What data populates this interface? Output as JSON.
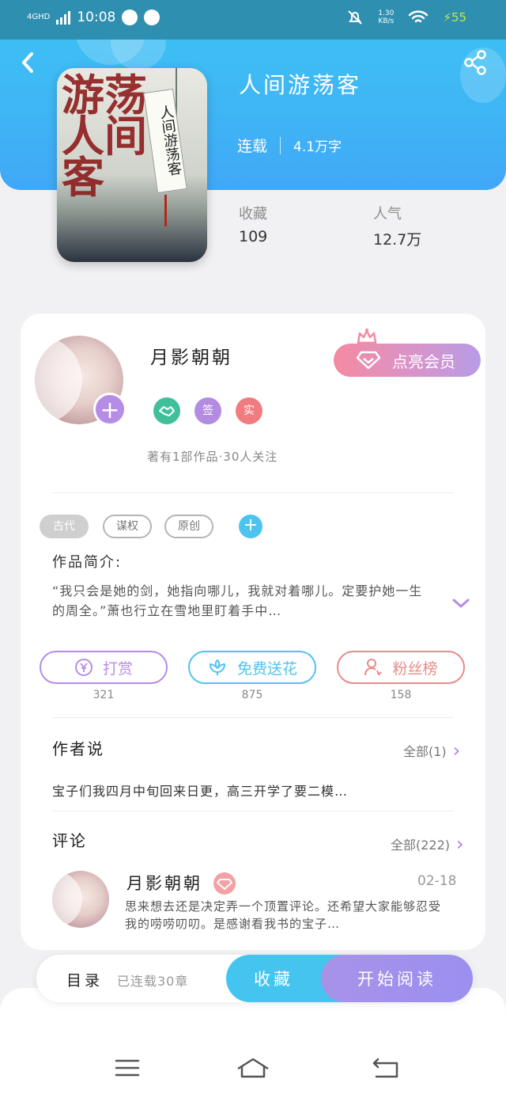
{
  "status_bar": {
    "network": "4GHD",
    "time": "10:08",
    "speed_value": "1.30",
    "speed_unit": "KB/s",
    "battery": "55"
  },
  "book": {
    "title": "人间游荡客",
    "status": "连载",
    "word_count": "4.1万字",
    "cover_title": "人间游荡客",
    "cover_calligraphy": "游荡人间客"
  },
  "stats": {
    "favorites_label": "收藏",
    "favorites_value": "109",
    "popularity_label": "人气",
    "popularity_value": "12.7万"
  },
  "author": {
    "name": "月影朝朝",
    "vip_label": "点亮会员",
    "badges": [
      {
        "text": "",
        "color": "#3fbf9b",
        "icon": "handshake-icon"
      },
      {
        "text": "签",
        "color": "#b38be0"
      },
      {
        "text": "实",
        "color": "#f07c80"
      }
    ],
    "subtitle": "著有1部作品·30人关注"
  },
  "tags": [
    "古代",
    "谋权",
    "原创"
  ],
  "intro": {
    "title": "作品简介:",
    "text": "“我只会是她的剑，她指向哪儿，我就对着哪儿。定要护她一生的周全。”萧也行立在雪地里盯着手中…"
  },
  "actions": [
    {
      "label": "打赏",
      "count": "321",
      "color": "#b68ce6",
      "icon": "yen-icon"
    },
    {
      "label": "免费送花",
      "count": "875",
      "color": "#4dc4f0",
      "icon": "flower-icon"
    },
    {
      "label": "粉丝榜",
      "count": "158",
      "color": "#e88a8a",
      "icon": "user-icon"
    }
  ],
  "author_say": {
    "title": "作者说",
    "more": "全部(1)",
    "text": "宝子们我四月中旬回来日更，高三开学了要二模…"
  },
  "comments": {
    "title": "评论",
    "more": "全部(222)",
    "item": {
      "name": "月影朝朝",
      "date": "02-18",
      "text": "思来想去还是决定弄一个顶置评论。还希望大家能够忍受我的唠唠叨叨。是感谢看我书的宝子…"
    }
  },
  "bottom_bar": {
    "toc": "目录",
    "toc_sub": "已连载30章",
    "favorite": "收藏",
    "read": "开始阅读"
  },
  "colors": {
    "accent_blue": "#43c5ef",
    "accent_purple": "#b68ce6",
    "accent_pink": "#f48aa2"
  }
}
